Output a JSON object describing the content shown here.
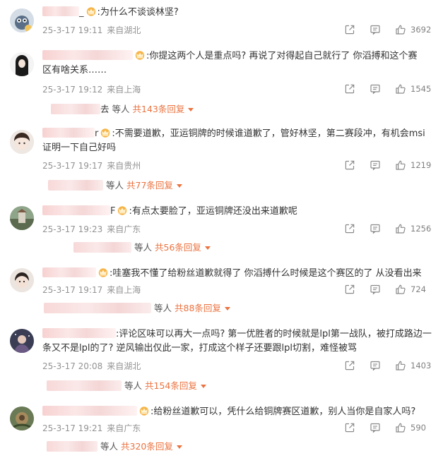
{
  "accent_color": "#eb7340",
  "comments": [
    {
      "name_tail": "_",
      "text": ":为什么不谈谈林坚?",
      "text_line2": "",
      "date": "25-3-17 19:11",
      "location": "来自湖北",
      "likes": "3692",
      "reply_like_prefix": "",
      "reply_deng": "",
      "reply_count": ""
    },
    {
      "name_tail": "",
      "text": ":你提这两个人是重点吗? 再说了对得起自己就行了 你滔搏和这个赛",
      "text_line2": "区有啥关系……",
      "date": "25-3-17 19:12",
      "location": "来自上海",
      "likes": "1545",
      "reply_like_prefix": "去",
      "reply_deng": "等人",
      "reply_count": "共143条回复"
    },
    {
      "name_tail": "r",
      "text": ":不需要道歉，亚运铜牌的时候谁道歉了，管好林坚，第二赛段冲，有机会msi",
      "text_line2": "证明一下自己好吗",
      "date": "25-3-17 19:17",
      "location": "来自贵州",
      "likes": "1219",
      "reply_like_prefix": "",
      "reply_deng": "等人",
      "reply_count": "共77条回复"
    },
    {
      "name_tail": "F",
      "text": ":有点太要脸了，亚运铜牌还没出来道歉呢",
      "text_line2": "",
      "date": "25-3-17 19:23",
      "location": "来自广东",
      "likes": "1256",
      "reply_like_prefix": "",
      "reply_deng": "等人",
      "reply_count": "共56条回复"
    },
    {
      "name_tail": "",
      "text": ":哇塞我不懂了给粉丝道歉就得了 你滔搏什么时候是这个赛区的了 从没看出来",
      "text_line2": "",
      "date": "25-3-17 19:17",
      "location": "来自上海",
      "likes": "724",
      "reply_like_prefix": "",
      "reply_deng": "等人",
      "reply_count": "共88条回复"
    },
    {
      "name_tail": "",
      "text": ":评论区味可以再大一点吗? 第一优胜者的时候就是lpl第一战队，被打成路边一",
      "text_line2": "条又不是lpl的了? 逆风输出仅此一家，打成这个样子还要跟lpl切割，难怪被骂",
      "date": "25-3-17 20:08",
      "location": "来自湖北",
      "likes": "1403",
      "reply_like_prefix": "",
      "reply_deng": "等人",
      "reply_count": "共154条回复"
    },
    {
      "name_tail": "",
      "text": ":给粉丝道歉可以，凭什么给铜牌赛区道歉，别人当你是自家人吗?",
      "text_line2": "",
      "date": "25-3-17 19:21",
      "location": "来自广东",
      "likes": "590",
      "reply_like_prefix": "",
      "reply_deng": "等人",
      "reply_count": "共320条回复"
    }
  ]
}
